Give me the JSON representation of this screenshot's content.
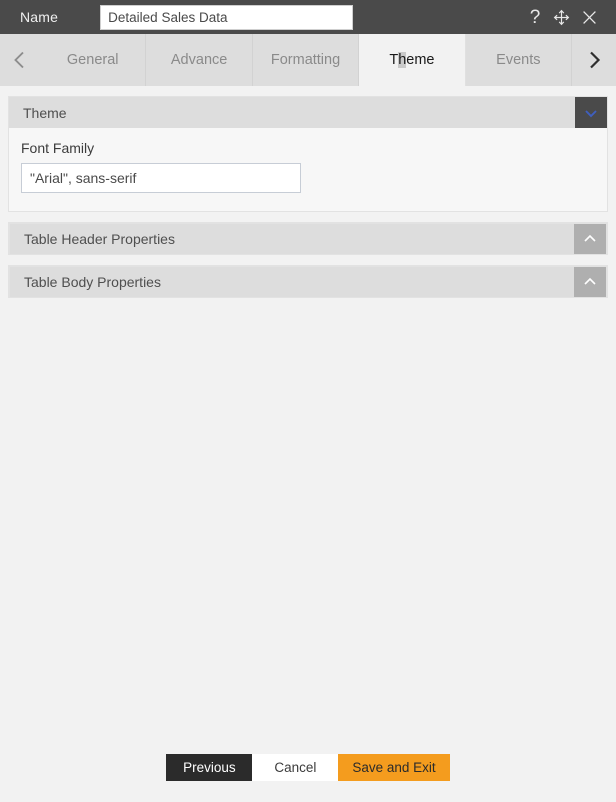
{
  "titlebar": {
    "name_label": "Name",
    "name_value": "Detailed Sales Data",
    "name_placeholder": "Name",
    "help_icon": "question-mark-icon",
    "move_icon": "move-four-arrows-icon",
    "close_icon": "close-x-icon"
  },
  "tabbar": {
    "prev_arrow": "chevron-left-icon",
    "next_arrow": "chevron-right-icon",
    "tabs": [
      {
        "label": "General",
        "active": false
      },
      {
        "label": "Advance",
        "active": false
      },
      {
        "label": "Formatting",
        "active": false
      },
      {
        "label": "Theme",
        "active": true
      },
      {
        "label": "Events",
        "active": false
      }
    ],
    "active_tab": "Theme",
    "active_tab_pre": "T",
    "active_tab_sel": "h",
    "active_tab_post": "eme"
  },
  "sections": {
    "theme": {
      "title": "Theme",
      "expanded": true,
      "toggle_icon": "chevron-down-icon",
      "font_family_label": "Font Family",
      "font_family_value": "\"Arial\", sans-serif",
      "font_family_placeholder": "Font Family"
    },
    "table_header": {
      "title": "Table Header Properties",
      "expanded": false,
      "toggle_icon": "chevron-up-icon"
    },
    "table_body": {
      "title": "Table Body Properties",
      "expanded": false,
      "toggle_icon": "chevron-up-icon"
    }
  },
  "footer": {
    "previous_label": "Previous",
    "cancel_label": "Cancel",
    "save_label": "Save and Exit"
  },
  "colors": {
    "titlebar_bg": "#4a4a4a",
    "tabbar_bg": "#dddddd",
    "page_bg": "#f2f2f2",
    "section_header_bg": "#dddddd",
    "toggle_open_bg": "#4a4a4a",
    "toggle_open_icon": "#3f5fbf",
    "toggle_collapsed_bg": "#afafaf",
    "accent_orange": "#f49c1e",
    "previous_bg": "#2b2b2b"
  }
}
